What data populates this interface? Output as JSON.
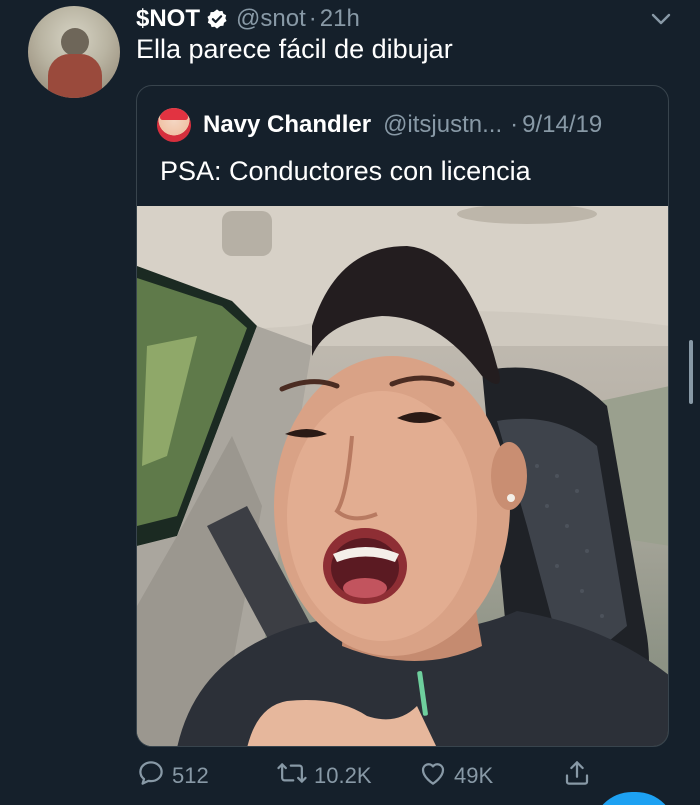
{
  "tweet": {
    "name": "$NOT",
    "handle": "@snot",
    "separator": "·",
    "time": "21h",
    "text": "Ella parece fácil de dibujar",
    "avatar_icon": "user-avatar",
    "verified_icon": "verified-badge-icon"
  },
  "quoted": {
    "name": "Navy Chandler",
    "handle": "@itsjustn...",
    "separator": "·",
    "date": "9/14/19",
    "text": "PSA: Conductores con licencia",
    "media_description_icon": "video-thumbnail"
  },
  "actions": {
    "replies": "512",
    "retweets": "10.2K",
    "likes": "49K"
  },
  "colors": {
    "background": "#15202b",
    "primary_text": "#ffffff",
    "secondary_text": "#8899a6",
    "border": "#38444d",
    "accent": "#1da1f2"
  }
}
